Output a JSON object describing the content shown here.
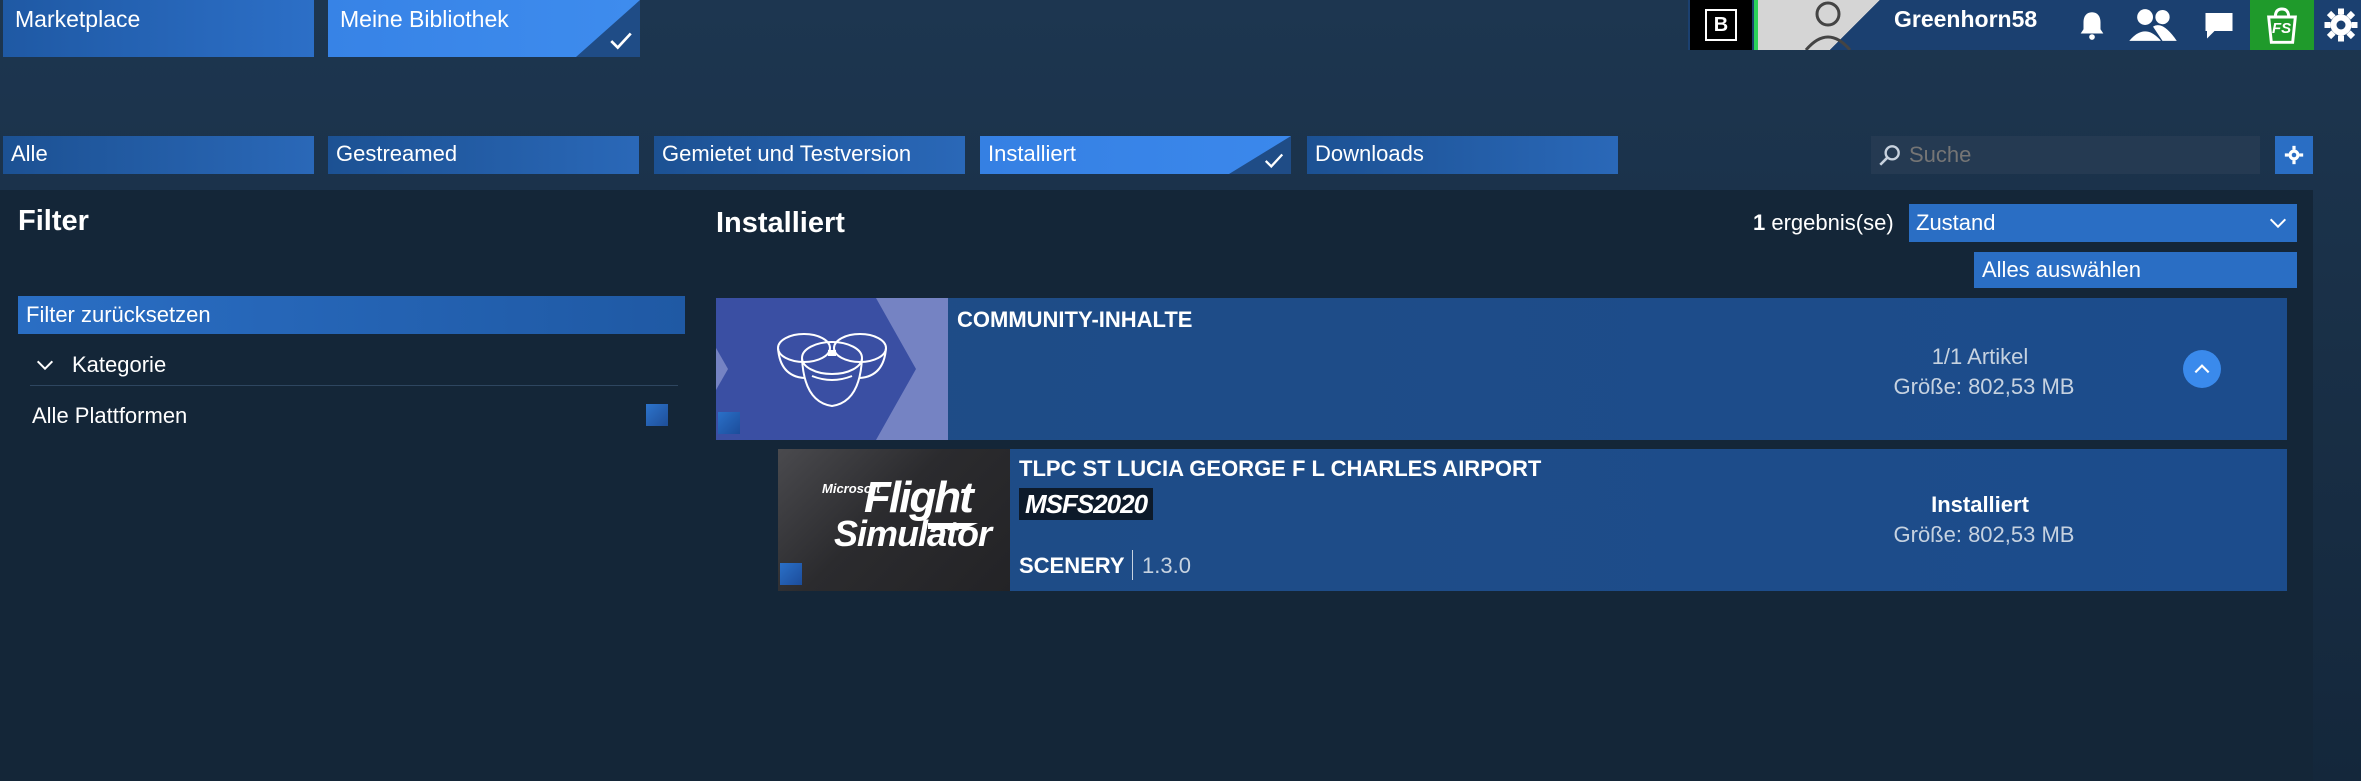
{
  "nav": {
    "marketplace": "Marketplace",
    "library": "Meine Bibliothek"
  },
  "user": {
    "badge": "B",
    "name": "Greenhorn58",
    "store_logo": "FS"
  },
  "icons": [
    "bell-icon",
    "friends-icon",
    "chat-icon",
    "store-icon",
    "gear-icon",
    "search-icon",
    "chevron-down-icon",
    "chevron-up-icon",
    "check-icon"
  ],
  "tabs": [
    "Alle",
    "Gestreamed",
    "Gemietet und Testversion",
    "Installiert",
    "Downloads"
  ],
  "search": {
    "placeholder": "Suche"
  },
  "filter": {
    "title": "Filter",
    "reset": "Filter zurücksetzen",
    "category": "Kategorie",
    "platforms": "Alle Plattformen"
  },
  "main": {
    "title": "Installiert",
    "result_count": "1",
    "result_label": "ergebnis(se)",
    "sort_value": "Zustand",
    "select_all": "Alles auswählen"
  },
  "group": {
    "title": "COMMUNITY-INHALTE",
    "count": "1/1 Artikel",
    "size": "Größe: 802,53 MB"
  },
  "item": {
    "title": "TLPC ST LUCIA GEORGE F L CHARLES AIRPORT",
    "platform": "MSFS2020",
    "type": "SCENERY",
    "version": "1.3.0",
    "status": "Installiert",
    "size": "Größe: 802,53 MB",
    "logo_top": "Microsoft",
    "logo_mid": "Flight",
    "logo_bot": "Simulator"
  },
  "colors": {
    "accent": "#3783e6",
    "nav_blue": "#1f59a4",
    "row_blue": "#1f4c86",
    "store_green": "#1f9a2b"
  }
}
